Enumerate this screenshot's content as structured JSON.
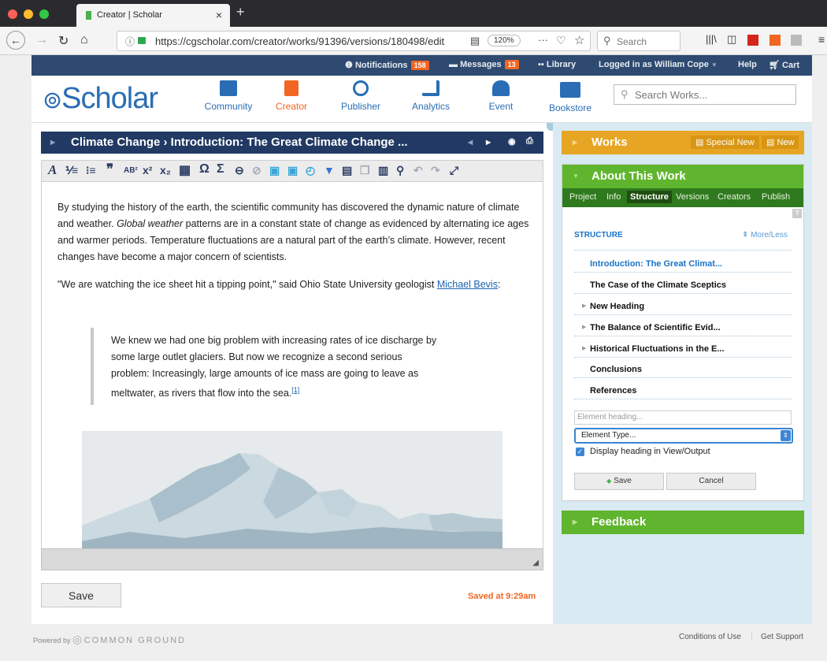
{
  "browser": {
    "tab_title": "Creator | Scholar",
    "url": "https://cgscholar.com/creator/works/91396/versions/180498/edit",
    "zoom": "120%",
    "search_placeholder": "Search"
  },
  "topstrip": {
    "notifications_label": "Notifications",
    "notifications_count": "158",
    "messages_label": "Messages",
    "messages_count": "13",
    "library_label": "Library",
    "logged_in": "Logged in as William Cope",
    "help": "Help",
    "cart": "Cart"
  },
  "header": {
    "logo": "Scholar",
    "modules": [
      "Community",
      "Creator",
      "Publisher",
      "Analytics",
      "Event",
      "Bookstore"
    ],
    "search_placeholder": "Search Works..."
  },
  "editor": {
    "breadcrumb": "Climate Change › Introduction: The Great Climate Change ...",
    "para1_pre": "By studying the history of the earth, the scientific community has discovered the dynamic nature of climate and weather. ",
    "para1_em": "Global weather",
    "para1_post": " patterns are in a constant state of change as evidenced by alternating ice ages and warmer periods. Temperature fluctuations are a natural part of the earth’s climate. However, recent changes have become a major concern of scientists.",
    "para2_pre": "\"We are watching the ice sheet hit a tipping point,\" said Ohio State University geologist ",
    "para2_link": "Michael Bevis",
    "para2_post": ":",
    "quote": "We knew we had one big problem with increasing rates of ice discharge by some large outlet glaciers. But now we recognize a second serious problem: Increasingly, large amounts of ice mass are going to leave as meltwater, as rivers that flow into the sea.",
    "footnote": "[1]",
    "save_label": "Save",
    "saved_status": "Saved at 9:29am"
  },
  "sidebar": {
    "works_title": "Works",
    "special_new": "Special New",
    "new": "New",
    "about_title": "About This Work",
    "tabs": [
      "Project",
      "Info",
      "Structure",
      "Versions",
      "Creators",
      "Publish"
    ],
    "structure_title": "STRUCTURE",
    "more_less": "More/Less",
    "structure_items": [
      "Introduction: The Great Climat...",
      "The Case of the Climate Sceptics",
      "New Heading",
      "The Balance of Scientific Evid...",
      "Historical Fluctuations in the E...",
      "Conclusions",
      "References"
    ],
    "element_heading_placeholder": "Element heading...",
    "element_type": "Element Type...",
    "display_heading": "Display heading in View/Output",
    "save": "Save",
    "cancel": "Cancel",
    "feedback_title": "Feedback"
  },
  "footer": {
    "powered_by": "Powered by",
    "brand": "COMMON GROUND",
    "conditions": "Conditions of Use",
    "support": "Get Support"
  },
  "colors": {
    "accent_blue": "#2a6db5",
    "works_orange": "#e6a623",
    "about_green": "#60b52e",
    "notification_badge": "#f26522",
    "breadcrumb_navy": "#213963"
  }
}
